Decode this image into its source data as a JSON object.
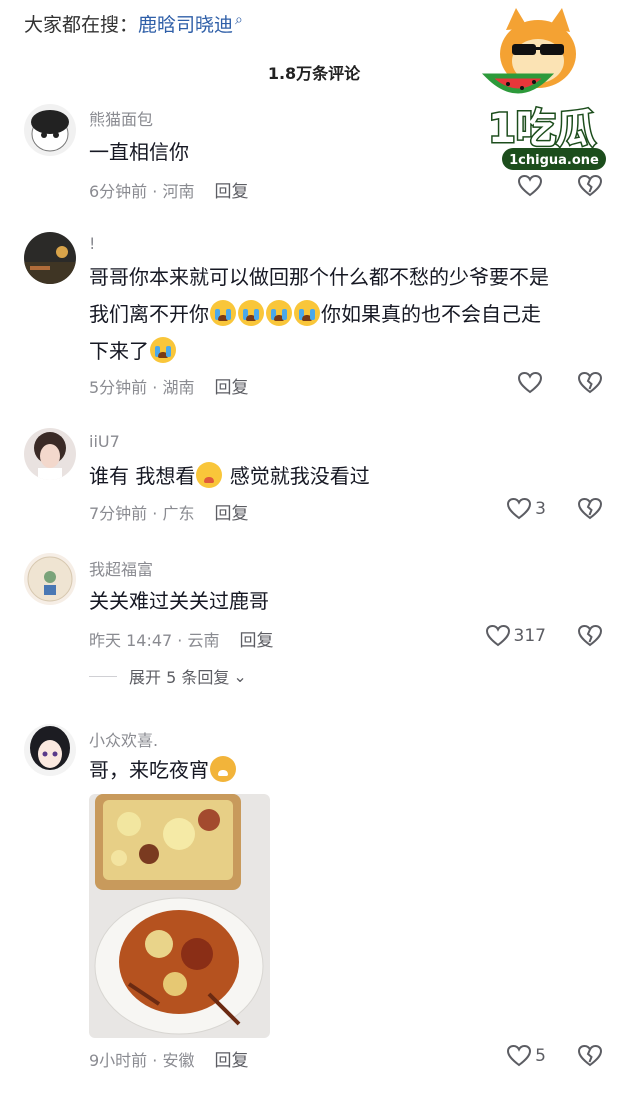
{
  "search": {
    "prefix": "大家都在搜：",
    "keyword": "鹿晗司晓迪"
  },
  "comments_count": "1.8万条评论",
  "logo": {
    "text": "1吃瓜",
    "url": "1chigua.one"
  },
  "comments": [
    {
      "user": "熊猫面包",
      "text": "一直相信你",
      "time": "6分钟前 · 河南",
      "reply": "回复",
      "likes": ""
    },
    {
      "user": "!",
      "text_line1": "哥哥你本来就可以做回那个什么都不愁的少爷要不是",
      "text_line2a": "我们离不开你",
      "text_line2b": "你如果真的也不会自己走",
      "text_line3": "下来了",
      "time": "5分钟前 · 湖南",
      "reply": "回复",
      "likes": ""
    },
    {
      "user": "iiU7",
      "text_a": "谁有 我想看",
      "text_b": "感觉就我没看过",
      "time": "7分钟前 · 广东",
      "reply": "回复",
      "likes": "3"
    },
    {
      "user": "我超福富",
      "text": "关关难过关关过鹿哥",
      "time": "昨天 14:47 · 云南",
      "reply": "回复",
      "likes": "317"
    },
    {
      "user": "小众欢喜.",
      "text": "哥，来吃夜宵",
      "time": "9小时前 · 安徽",
      "reply": "回复",
      "likes": "5"
    }
  ],
  "expand_replies": "展开 5 条回复",
  "colors": {
    "link": "#2f5fa8",
    "meta": "#8a8b91",
    "text": "#161823"
  }
}
